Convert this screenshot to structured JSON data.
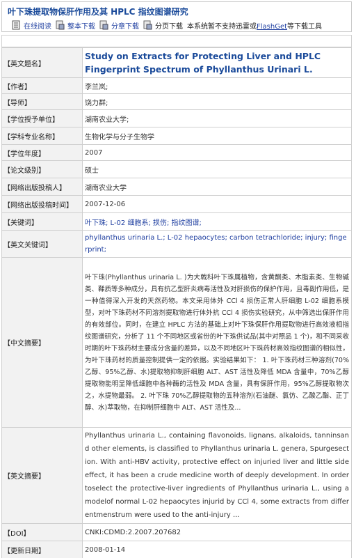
{
  "header": {
    "title": "叶下珠提取物保肝作用及其 HPLC 指纹图谱研究",
    "tools": [
      {
        "label": "在线阅读",
        "icon": "document-icon"
      },
      {
        "label": "整本下载",
        "icon": "download-icon"
      },
      {
        "label": "分章下载",
        "icon": "download-icon"
      },
      {
        "label": "分页下载",
        "icon": "download-icon"
      }
    ],
    "notice_prefix": "本系统暂不支持迅雷或",
    "notice_link": "FlashGet",
    "notice_suffix": "等下载工具"
  },
  "rows": [
    {
      "label": "【英文题名】",
      "value": "Study on Extracts for Protecting Liver and HPLC Fingerprint Spectrum of Phyllanthus Urinari L."
    },
    {
      "label": "【作者】",
      "value": "李兰岚;"
    },
    {
      "label": "【导师】",
      "value": "饶力群;"
    },
    {
      "label": "【学位授予单位】",
      "value": "湖南农业大学;"
    },
    {
      "label": "【学科专业名称】",
      "value": "生物化学与分子生物学"
    },
    {
      "label": "【学位年度】",
      "value": "2007"
    },
    {
      "label": "【论文级别】",
      "value": "硕士"
    },
    {
      "label": "【网络出版投稿人】",
      "value": "湖南农业大学"
    },
    {
      "label": "【网络出版投稿时间】",
      "value": "2007-12-06"
    },
    {
      "label": "【关键词】",
      "value": "叶下珠; L-02 细胞系; 损伤; 指纹图谱;"
    },
    {
      "label": "【英文关键词】",
      "value": "phyllanthus urinaria L.; L-02 hepaocytes; carbon tetrachloride; injury; fingerprint;"
    },
    {
      "label": "【中文摘要】",
      "value": "叶下珠(Phyllanthus urinaria L. )为大戟科叶下珠属植物，含黄酮类、木脂素类、生物碱类、鞣质等多种成分，具有抗乙型肝炎病毒活性及对肝损伤的保护作用，且毒副作用低，是一种值得深入开发的天然药物。本文采用体外 CCl 4 损伤正常人肝细胞 L-02 细胞系模型，对叶下珠药材不同溶剂提取物进行体外抗 CCl 4 损伤实验研究，从中筛选出保肝作用的有效部位。同时，在建立 HPLC 方法的基础上对叶下珠保肝作用提取物进行高效液相指纹图谱研究，分析了 11 个不同地区或省份的叶下珠供试品(其中对照品 1 个)，和不同采收时期的叶下珠药材主要成分含量的差异，以及不同地区叶下珠药材高效指纹图谱的相似性，为叶下珠药材的质量控制提供一定的依据。实验结果如下：  1. 叶下珠药材三种溶剂(70%乙醇、95%乙醇、水)提取物抑制肝细胞 ALT、AST 活性及降低 MDA 含量中，70%乙醇提取物能明显降低细胞中各种酶的活性及 MDA 含量，具有保肝作用，95%乙醇提取物次之，水提物最弱。 2. 叶下珠 70%乙醇提取物的五种溶剂(石油醚、氯仿、乙酸乙酯、正丁醇、水)萃取物，在抑制肝细胞中 ALT、AST 活性及..."
    },
    {
      "label": "【英文摘要】",
      "value": "Phyllanthus urinaria L., containing flavonoids, lignans, alkaloids, tanninsand other elements, is classified to Phyllanthus urinaria L. genera, Spurgesection. With anti-HBV activity, protective effect on injuried liver and little side effect, it has been a crude medicine worth of deeply development. In order toselect the protective-liver ingredients of Phyllanthus urinaria L., using a modelof normal L-02 hepaocytes injurid by CCl 4, some extracts from differentmenstrum were used to the anti-injury ..."
    },
    {
      "label": "【DOI】",
      "value": "CNKI:CDMD:2.2007.207682"
    },
    {
      "label": "【更新日期】",
      "value": "2008-01-14"
    }
  ]
}
